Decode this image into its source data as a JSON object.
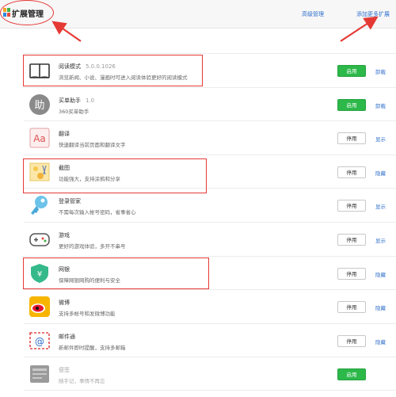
{
  "header": {
    "title": "扩展管理",
    "advanced_link": "高级管理",
    "add_more_link": "添加更多扩展"
  },
  "extensions": [
    {
      "name": "阅读模式",
      "version": "5.0.0.1026",
      "desc": "浏览新闻、小说、漫画时可进入阅读体验更好的阅读模式",
      "button": "启用",
      "action": "卸载",
      "icon": "book-icon"
    },
    {
      "name": "买单助手",
      "version": "1.0",
      "desc": "360买单助手",
      "button": "启用",
      "action": "卸载",
      "icon": "helper-icon"
    },
    {
      "name": "翻译",
      "version": "",
      "desc": "快速翻译当前页面和翻译文字",
      "button": "停用",
      "action": "显示",
      "icon": "translate-icon"
    },
    {
      "name": "截图",
      "version": "",
      "desc": "功能强大，支持涂鸦和分享",
      "button": "停用",
      "action": "隐藏",
      "icon": "screenshot-icon"
    },
    {
      "name": "登录管家",
      "version": "",
      "desc": "不需每次输入帐号密码，省事省心",
      "button": "停用",
      "action": "显示",
      "icon": "key-icon"
    },
    {
      "name": "游戏",
      "version": "",
      "desc": "更好的游戏体验，多开不串号",
      "button": "停用",
      "action": "显示",
      "icon": "gamepad-icon"
    },
    {
      "name": "网银",
      "version": "",
      "desc": "保障网银网购的便利与安全",
      "button": "停用",
      "action": "隐藏",
      "icon": "shield-icon"
    },
    {
      "name": "微博",
      "version": "",
      "desc": "支持多帐号和发微博功能",
      "button": "停用",
      "action": "隐藏",
      "icon": "weibo-icon"
    },
    {
      "name": "邮件通",
      "version": "",
      "desc": "新邮件即时提醒，支持多邮箱",
      "button": "停用",
      "action": "隐藏",
      "icon": "mail-icon"
    },
    {
      "name": "便签",
      "version": "",
      "desc": "随手记，事情不再忘",
      "button": "启用",
      "action": "",
      "icon": "notes-icon"
    }
  ],
  "colors": {
    "annotation": "#e53935",
    "enable_button": "#2db84a",
    "link": "#2e6fcc"
  }
}
